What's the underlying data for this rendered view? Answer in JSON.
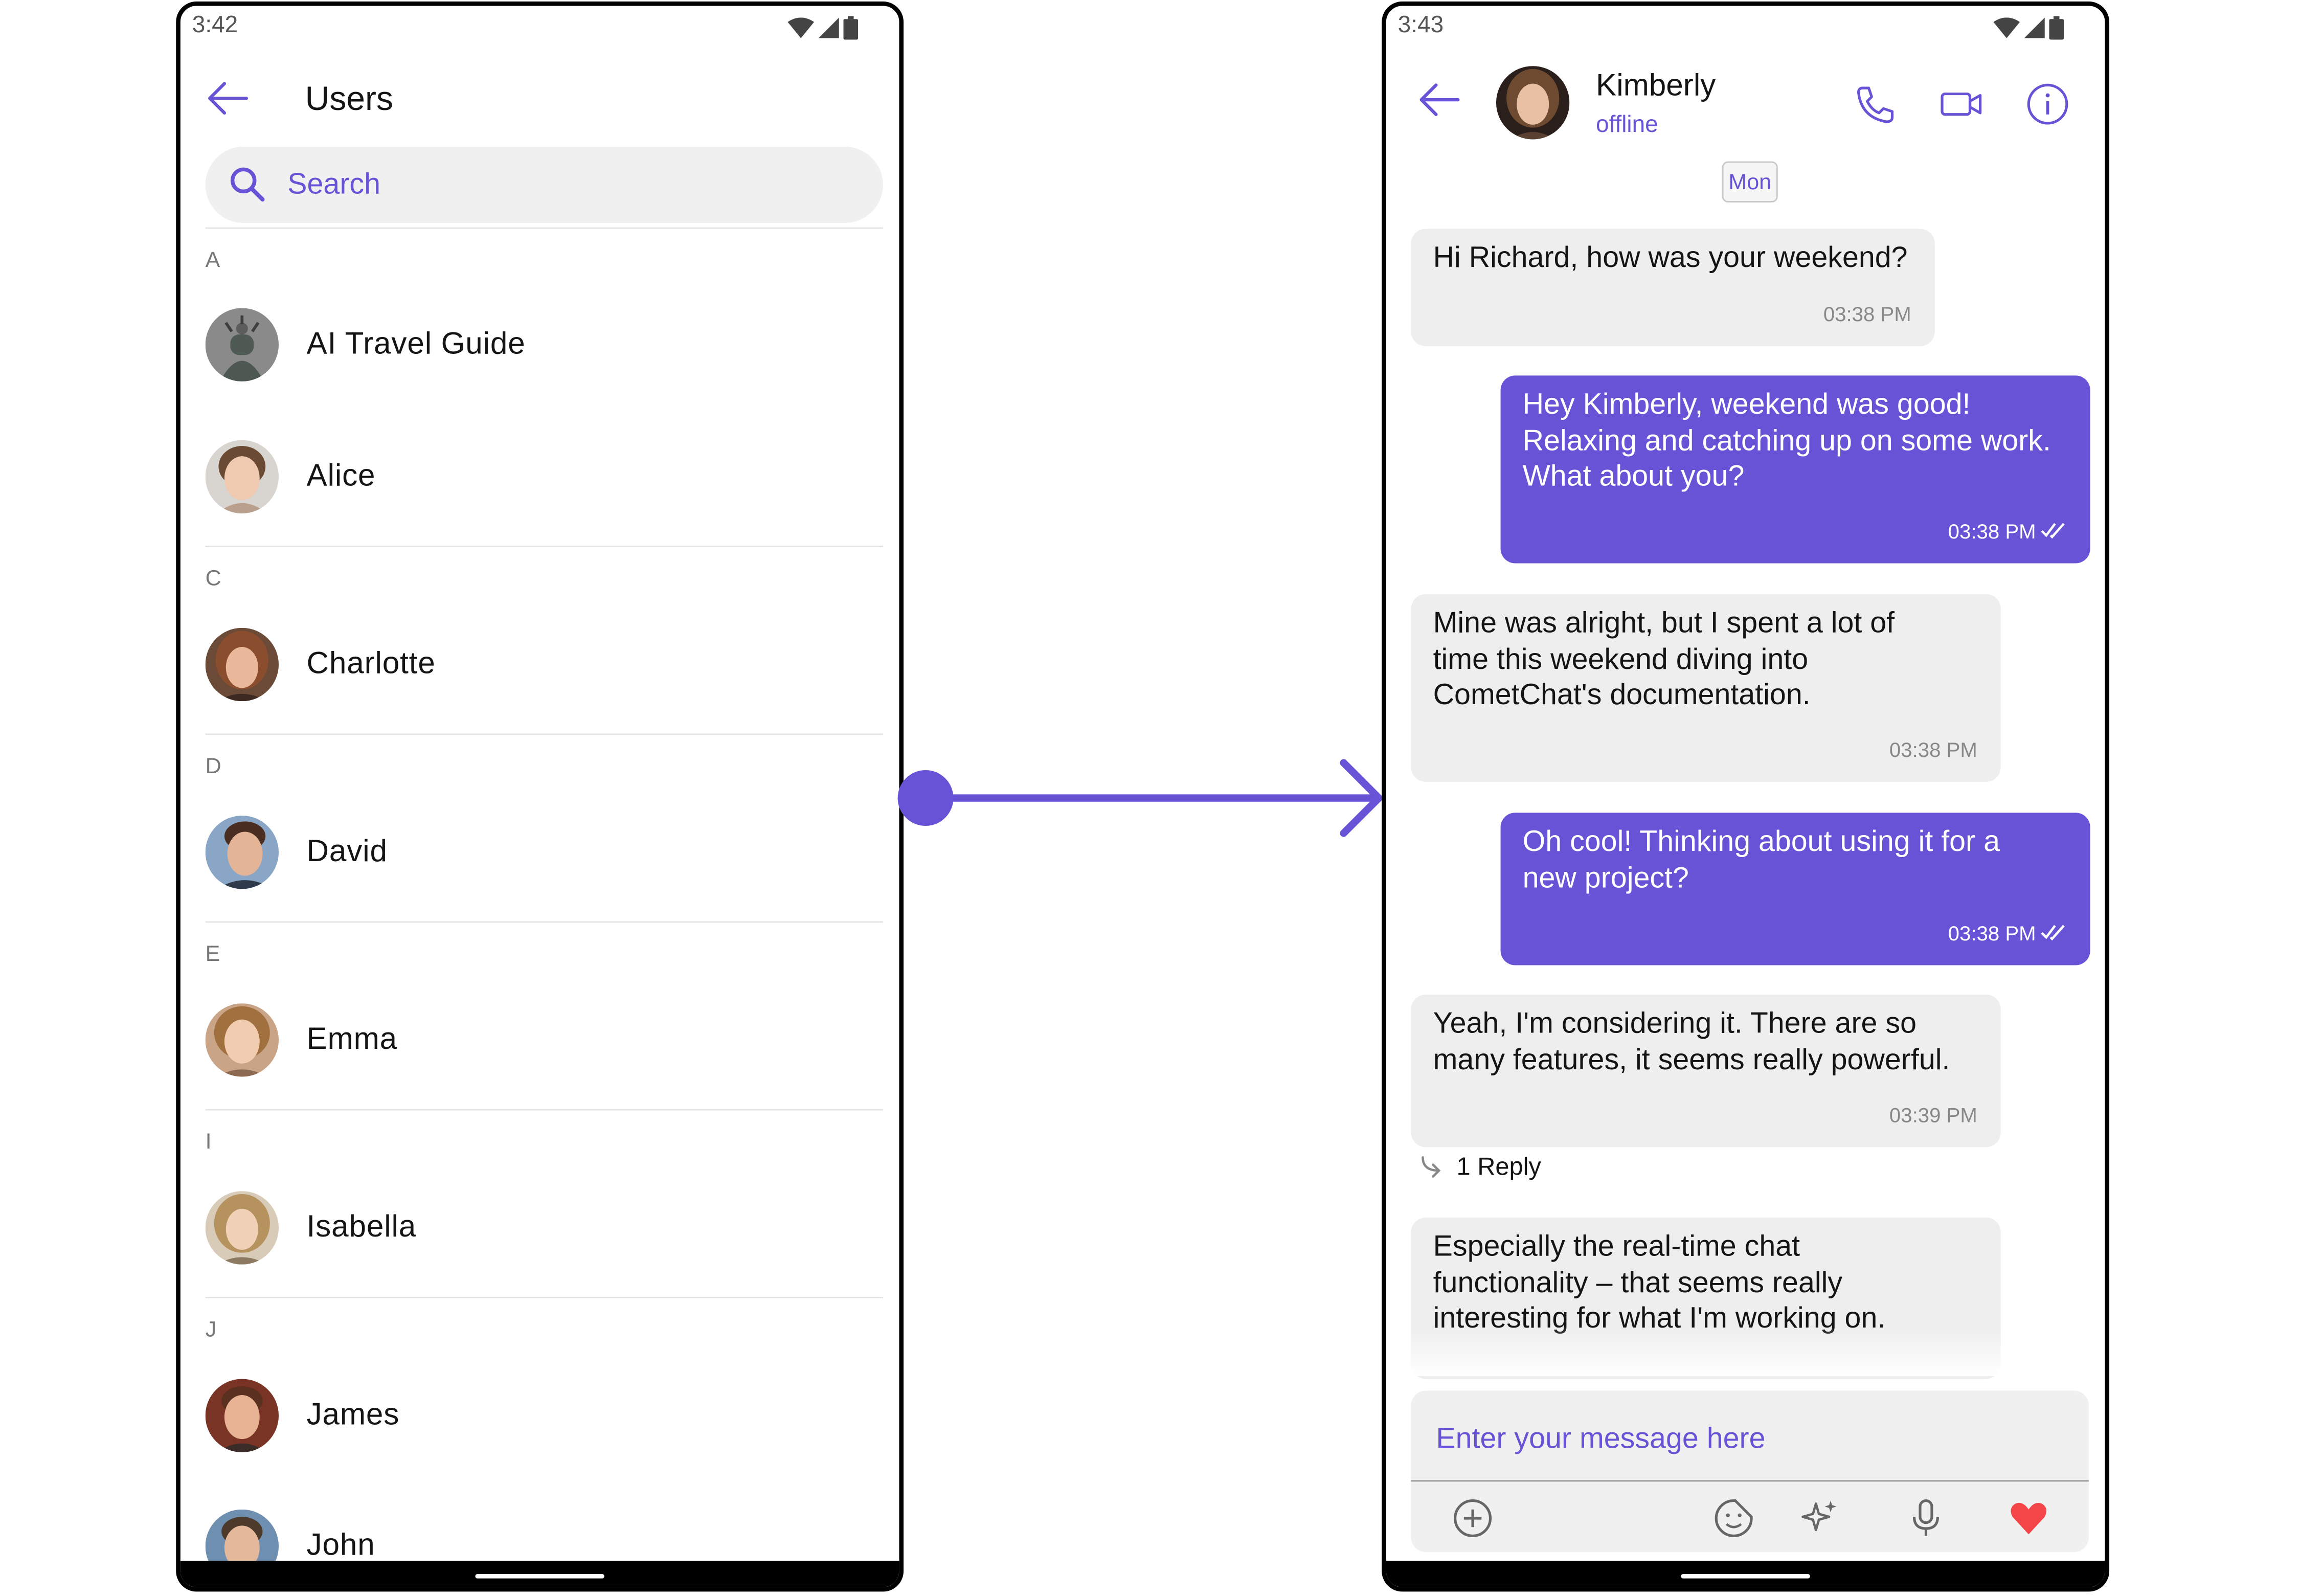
{
  "left": {
    "status_time": "3:42",
    "title": "Users",
    "search_placeholder": "Search",
    "sections": [
      {
        "letter": "A",
        "users": [
          "AI Travel Guide",
          "Alice"
        ]
      },
      {
        "letter": "C",
        "users": [
          "Charlotte"
        ]
      },
      {
        "letter": "D",
        "users": [
          "David"
        ]
      },
      {
        "letter": "E",
        "users": [
          "Emma"
        ]
      },
      {
        "letter": "I",
        "users": [
          "Isabella"
        ]
      },
      {
        "letter": "J",
        "users": [
          "James",
          "John"
        ]
      }
    ]
  },
  "right": {
    "status_time": "3:43",
    "contact_name": "Kimberly",
    "contact_status": "offline",
    "date_chip": "Mon",
    "messages": [
      {
        "dir": "in",
        "text": "Hi Richard, how was your weekend?",
        "time": "03:38 PM"
      },
      {
        "dir": "out",
        "text": "Hey Kimberly, weekend was good!\nRelaxing and catching up on some work.\nWhat about you?",
        "time": "03:38 PM"
      },
      {
        "dir": "in",
        "text": "Mine was alright, but I spent a lot of\ntime this weekend diving into\nCometChat's documentation.",
        "time": "03:38 PM"
      },
      {
        "dir": "out",
        "text": "Oh cool! Thinking about using it for a\nnew project?",
        "time": "03:38 PM"
      },
      {
        "dir": "in",
        "text": "Yeah, I'm considering it.  There are so\nmany features, it seems really powerful.",
        "time": "03:39 PM"
      },
      {
        "dir": "in",
        "text": "Especially the real-time chat\nfunctionality – that seems really\ninteresting for what I'm working on.",
        "time": ""
      }
    ],
    "reply_label": "1 Reply",
    "composer_placeholder": "Enter your message here"
  },
  "colors": {
    "accent": "#6852d6",
    "incoming_bubble": "#eeeeee",
    "heart": "#f44649"
  }
}
